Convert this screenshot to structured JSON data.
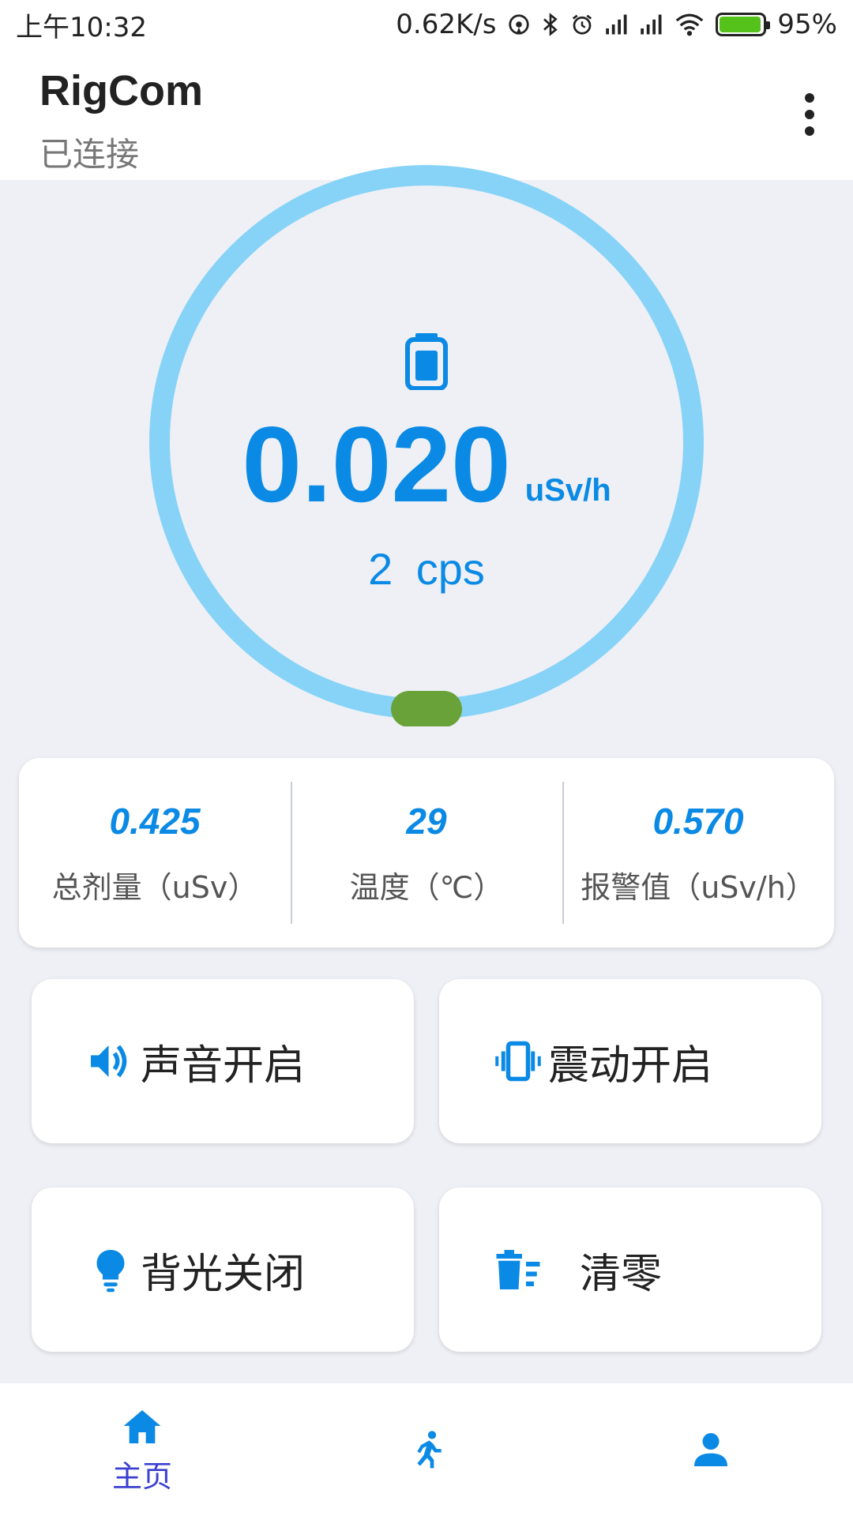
{
  "status_bar": {
    "time": "上午10:32",
    "net_speed": "0.62K/s",
    "battery": "95%",
    "battery_level": 0.95,
    "icons": [
      "hotspot-icon",
      "bluetooth-icon",
      "alarm-icon",
      "signal-icon",
      "signal-icon",
      "wifi-icon",
      "battery-charging-icon"
    ]
  },
  "app_bar": {
    "title": "RigCom",
    "subtitle": "已连接",
    "menu_icon": "more-vertical-icon"
  },
  "gauge": {
    "icon": "battery-icon",
    "value": "0.020",
    "unit": "uSv/h",
    "cps_value": "2",
    "cps_unit": "cps",
    "colors": {
      "ring": "#87d3f8",
      "indicator": "#6aa23a",
      "value": "#0b8ae5"
    }
  },
  "stats": [
    {
      "value": "0.425",
      "label": "总剂量（uSv）"
    },
    {
      "value": "29",
      "label": "温度（℃）"
    },
    {
      "value": "0.570",
      "label": "报警值（uSv/h）"
    }
  ],
  "controls": {
    "sound": {
      "label": "声音开启",
      "icon": "speaker-icon"
    },
    "vibration": {
      "label": "震动开启",
      "icon": "vibrate-icon"
    },
    "backlight": {
      "label": "背光关闭",
      "icon": "lightbulb-icon"
    },
    "clear": {
      "label": "清零",
      "icon": "clear-all-icon"
    }
  },
  "bottom_nav": {
    "home": {
      "label": "主页",
      "icon": "home-icon",
      "active": true
    },
    "activity": {
      "icon": "run-icon"
    },
    "profile": {
      "icon": "person-icon"
    },
    "colors": {
      "active": "#3b3fd1",
      "icon": "#0b8ae5"
    }
  }
}
